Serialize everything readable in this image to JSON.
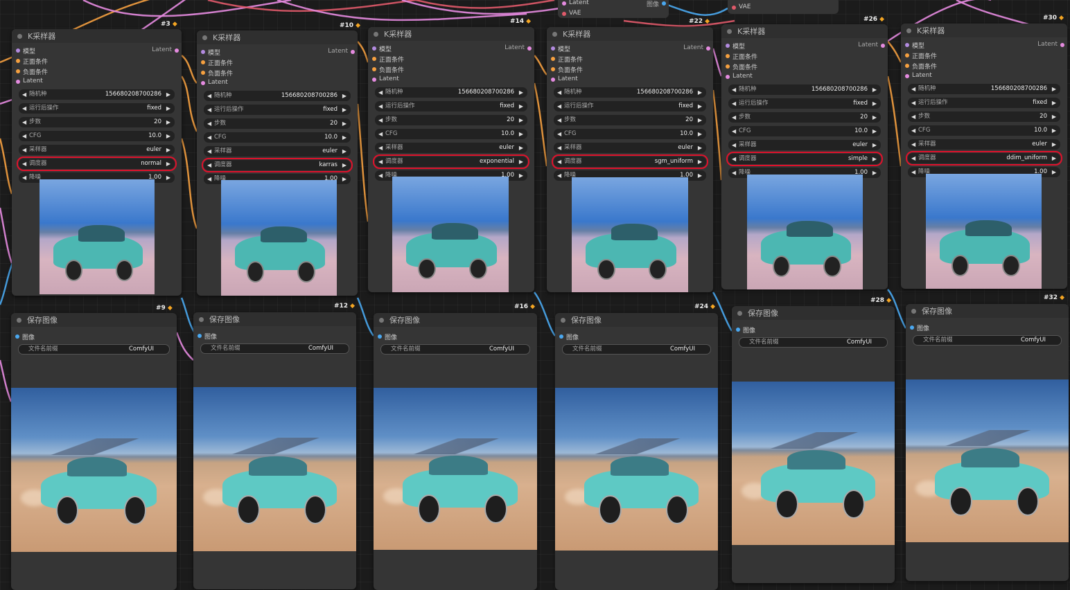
{
  "top_nodes": {
    "left": {
      "outputs": [
        {
          "label": "Latent",
          "color": "#e58be0"
        },
        {
          "label": "VAE",
          "color": "#e05a6a"
        }
      ],
      "right_output": "图像"
    },
    "right": {
      "input": "VAE"
    }
  },
  "ksamplers": [
    {
      "id": "#3",
      "title": "K采样器",
      "inputs": [
        {
          "label": "模型",
          "color": "#b38be0"
        },
        {
          "label": "正面条件",
          "color": "#f5a040"
        },
        {
          "label": "负面条件",
          "color": "#f5a040"
        },
        {
          "label": "Latent",
          "color": "#e58be0"
        }
      ],
      "output": "Latent",
      "widgets": [
        {
          "name": "随机种",
          "value": "156680208700286"
        },
        {
          "name": "运行后操作",
          "value": "fixed"
        },
        {
          "name": "步数",
          "value": "20"
        },
        {
          "name": "CFG",
          "value": "10.0"
        },
        {
          "name": "采样器",
          "value": "euler"
        },
        {
          "name": "调度器",
          "value": "normal",
          "highlight": true
        },
        {
          "name": "降噪",
          "value": "1.00"
        }
      ]
    },
    {
      "id": "#10",
      "title": "K采样器",
      "inputs": [
        {
          "label": "模型",
          "color": "#b38be0"
        },
        {
          "label": "正面条件",
          "color": "#f5a040"
        },
        {
          "label": "负面条件",
          "color": "#f5a040"
        },
        {
          "label": "Latent",
          "color": "#e58be0"
        }
      ],
      "output": "Latent",
      "widgets": [
        {
          "name": "随机种",
          "value": "156680208700286"
        },
        {
          "name": "运行后操作",
          "value": "fixed"
        },
        {
          "name": "步数",
          "value": "20"
        },
        {
          "name": "CFG",
          "value": "10.0"
        },
        {
          "name": "采样器",
          "value": "euler"
        },
        {
          "name": "调度器",
          "value": "karras",
          "highlight": true
        },
        {
          "name": "降噪",
          "value": "1.00"
        }
      ]
    },
    {
      "id": "#14",
      "title": "K采样器",
      "inputs": [
        {
          "label": "模型",
          "color": "#b38be0"
        },
        {
          "label": "正面条件",
          "color": "#f5a040"
        },
        {
          "label": "负面条件",
          "color": "#f5a040"
        },
        {
          "label": "Latent",
          "color": "#e58be0"
        }
      ],
      "output": "Latent",
      "widgets": [
        {
          "name": "随机种",
          "value": "156680208700286"
        },
        {
          "name": "运行后操作",
          "value": "fixed"
        },
        {
          "name": "步数",
          "value": "20"
        },
        {
          "name": "CFG",
          "value": "10.0"
        },
        {
          "name": "采样器",
          "value": "euler"
        },
        {
          "name": "调度器",
          "value": "exponential",
          "highlight": true
        },
        {
          "name": "降噪",
          "value": "1.00"
        }
      ]
    },
    {
      "id": "#22",
      "title": "K采样器",
      "inputs": [
        {
          "label": "模型",
          "color": "#b38be0"
        },
        {
          "label": "正面条件",
          "color": "#f5a040"
        },
        {
          "label": "负面条件",
          "color": "#f5a040"
        },
        {
          "label": "Latent",
          "color": "#e58be0"
        }
      ],
      "output": "Latent",
      "widgets": [
        {
          "name": "随机种",
          "value": "156680208700286"
        },
        {
          "name": "运行后操作",
          "value": "fixed"
        },
        {
          "name": "步数",
          "value": "20"
        },
        {
          "name": "CFG",
          "value": "10.0"
        },
        {
          "name": "采样器",
          "value": "euler"
        },
        {
          "name": "调度器",
          "value": "sgm_uniform",
          "highlight": true
        },
        {
          "name": "降噪",
          "value": "1.00"
        }
      ]
    },
    {
      "id": "#26",
      "title": "K采样器",
      "inputs": [
        {
          "label": "模型",
          "color": "#b38be0"
        },
        {
          "label": "正面条件",
          "color": "#f5a040"
        },
        {
          "label": "负面条件",
          "color": "#f5a040"
        },
        {
          "label": "Latent",
          "color": "#e58be0"
        }
      ],
      "output": "Latent",
      "widgets": [
        {
          "name": "随机种",
          "value": "156680208700286"
        },
        {
          "name": "运行后操作",
          "value": "fixed"
        },
        {
          "name": "步数",
          "value": "20"
        },
        {
          "name": "CFG",
          "value": "10.0"
        },
        {
          "name": "采样器",
          "value": "euler"
        },
        {
          "name": "调度器",
          "value": "simple",
          "highlight": true
        },
        {
          "name": "降噪",
          "value": "1.00"
        }
      ]
    },
    {
      "id": "#30",
      "title": "K采样器",
      "inputs": [
        {
          "label": "模型",
          "color": "#b38be0"
        },
        {
          "label": "正面条件",
          "color": "#f5a040"
        },
        {
          "label": "负面条件",
          "color": "#f5a040"
        },
        {
          "label": "Latent",
          "color": "#e58be0"
        }
      ],
      "output": "Latent",
      "widgets": [
        {
          "name": "随机种",
          "value": "156680208700286"
        },
        {
          "name": "运行后操作",
          "value": "fixed"
        },
        {
          "name": "步数",
          "value": "20"
        },
        {
          "name": "CFG",
          "value": "10.0"
        },
        {
          "name": "采样器",
          "value": "euler"
        },
        {
          "name": "调度器",
          "value": "ddim_uniform",
          "highlight": true
        },
        {
          "name": "降噪",
          "value": "1.00"
        }
      ]
    }
  ],
  "savers": [
    {
      "id": "#9",
      "title": "保存图像",
      "input": "图像",
      "input_color": "#4aa8f0",
      "widget": {
        "name": "文件名前缀",
        "value": "ComfyUI"
      }
    },
    {
      "id": "#12",
      "title": "保存图像",
      "input": "图像",
      "input_color": "#4aa8f0",
      "widget": {
        "name": "文件名前缀",
        "value": "ComfyUI"
      }
    },
    {
      "id": "#16",
      "title": "保存图像",
      "input": "图像",
      "input_color": "#4aa8f0",
      "widget": {
        "name": "文件名前缀",
        "value": "ComfyUI"
      }
    },
    {
      "id": "#24",
      "title": "保存图像",
      "input": "图像",
      "input_color": "#4aa8f0",
      "widget": {
        "name": "文件名前缀",
        "value": "ComfyUI"
      }
    },
    {
      "id": "#28",
      "title": "保存图像",
      "input": "图像",
      "input_color": "#4aa8f0",
      "widget": {
        "name": "文件名前缀",
        "value": "ComfyUI"
      }
    },
    {
      "id": "#32",
      "title": "保存图像",
      "input": "图像",
      "input_color": "#4aa8f0",
      "widget": {
        "name": "文件名前缀",
        "value": "ComfyUI"
      }
    }
  ],
  "colors": {
    "highlight": "#e0112b",
    "wire_pink": "#e58be0",
    "wire_red": "#e05a6a",
    "wire_orange": "#f5a040",
    "wire_blue": "#4aa8f0",
    "wire_purple": "#b38be0"
  },
  "icons": {
    "badge": "fox-icon",
    "arrow_left": "triangle-left-icon",
    "arrow_right": "triangle-right-icon"
  }
}
